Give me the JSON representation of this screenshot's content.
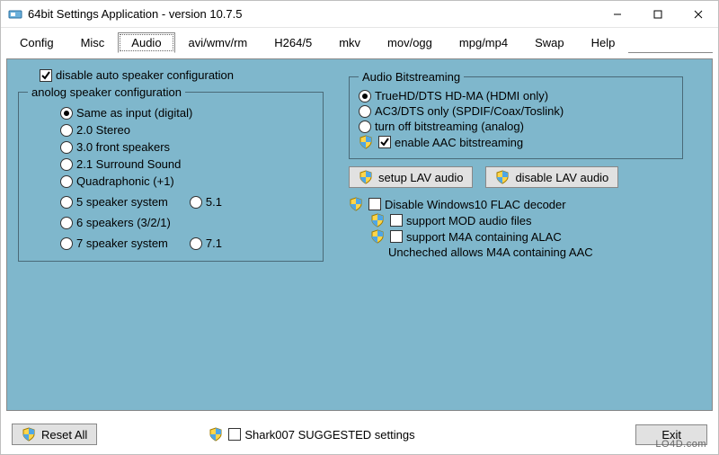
{
  "window": {
    "title": "64bit Settings Application - version 10.7.5"
  },
  "tabs": {
    "items": [
      "Config",
      "Misc",
      "Audio",
      "avi/wmv/rm",
      "H264/5",
      "mkv",
      "mov/ogg",
      "mpg/mp4",
      "Swap",
      "Help"
    ],
    "active_index": 2
  },
  "left": {
    "disable_auto_label": "disable auto speaker configuration",
    "group_label": "anolog speaker configuration",
    "options": {
      "same_as_input": "Same as input (digital)",
      "stereo20": "2.0 Stereo",
      "front30": "3.0 front speakers",
      "surround21": "2.1 Surround Sound",
      "quad": "Quadraphonic (+1)",
      "sys5": "5 speaker system",
      "five1": "5.1",
      "sys6": "6 speakers (3/2/1)",
      "sys7": "7 speaker system",
      "seven1": "7.1"
    }
  },
  "right": {
    "bitstream_group": "Audio Bitstreaming",
    "opt_truehd": "TrueHD/DTS HD-MA (HDMI only)",
    "opt_ac3": "AC3/DTS only (SPDIF/Coax/Toslink)",
    "opt_off": "turn off bitstreaming (analog)",
    "enable_aac": "enable AAC bitstreaming",
    "btn_setup_lav": "setup LAV audio",
    "btn_disable_lav": "disable LAV audio",
    "flac": "Disable Windows10 FLAC decoder",
    "mod": "support MOD audio files",
    "m4a": "support M4A containing ALAC",
    "note": "Uncheched allows M4A containing AAC"
  },
  "bottom": {
    "reset": "Reset All",
    "suggested": "Shark007 SUGGESTED settings",
    "exit": "Exit"
  },
  "watermark": "LO4D.com"
}
